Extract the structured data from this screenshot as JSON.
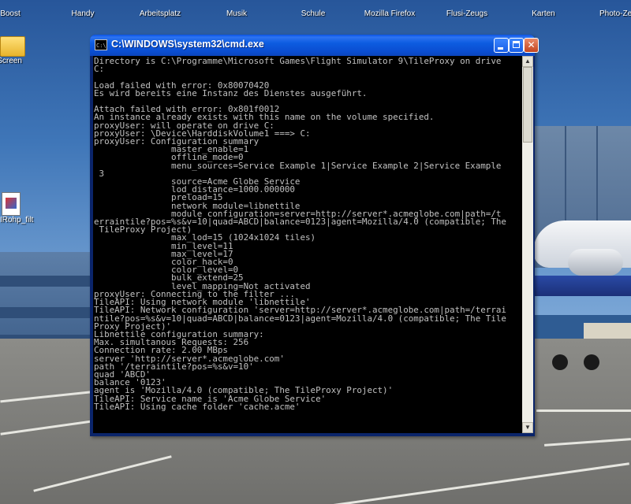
{
  "desktop": {
    "icons": [
      {
        "label": "Boost",
        "glyph": "folder-icon"
      },
      {
        "label": "Handy",
        "glyph": "folder-icon"
      },
      {
        "label": "Arbeitsplatz",
        "glyph": "computer-icon"
      },
      {
        "label": "Musik",
        "glyph": "folder-icon"
      },
      {
        "label": "Schule",
        "glyph": "folder-icon"
      },
      {
        "label": "Mozilla Firefox",
        "glyph": "firefox-icon"
      },
      {
        "label": "Flusi-Zeugs",
        "glyph": "folder-icon"
      },
      {
        "label": "Karten",
        "glyph": "folder-icon"
      },
      {
        "label": "Photo-Ze",
        "glyph": "folder-icon"
      },
      {
        "label": "Screen",
        "glyph": "folder-icon"
      },
      {
        "label": "IRohp_filt",
        "glyph": "document-icon"
      }
    ]
  },
  "window": {
    "title": "C:\\WINDOWS\\system32\\cmd.exe",
    "icon_text": "C:\\",
    "min_glyph": "_",
    "max_glyph": "□",
    "close_glyph": "✕",
    "scroll_up_glyph": "▲",
    "scroll_down_glyph": "▼"
  },
  "console": {
    "text": "Directory is C:\\Programme\\Microsoft Games\\Flight Simulator 9\\TileProxy on drive\nC:\n\nLoad failed with error: 0x80070420\nEs wird bereits eine Instanz des Dienstes ausgeführt.\n\nAttach failed with error: 0x801f0012\nAn instance already exists with this name on the volume specified.\nproxyUser: will operate on drive C:\nproxyUser: \\Device\\HarddiskVolume1 ===> C:\nproxyUser: Configuration summary\n               master_enable=1\n               offline_mode=0\n               menu_sources=Service Example 1|Service Example 2|Service Example\n 3\n               source=Acme Globe Service\n               lod_distance=1000.000000\n               preload=15\n               network module=libnettile\n               module configuration=server=http://server*.acmeglobe.com|path=/t\nerraintile?pos=%s&v=10|quad=ABCD|balance=0123|agent=Mozilla/4.0 (compatible; The\n TileProxy Project)\n               max_lod=15 (1024x1024 tiles)\n               min_level=11\n               max_level=17\n               color_hack=0\n               color_level=0\n               bulk_extend=25\n               level_mapping=Not activated\nproxyUser: Connecting to the filter ...\nTileAPI: Using network module 'libnettile'\nTileAPI: Network configuration 'server=http://server*.acmeglobe.com|path=/terrai\nntile?pos=%s&v=10|quad=ABCD|balance=0123|agent=Mozilla/4.0 (compatible; The Tile\nProxy Project)'\nLibnettile configuration summary:\nMax. simultanous Requests: 256\nConnection rate: 2.00 MBps\nserver 'http://server*.acmeglobe.com'\npath '/terraintile?pos=%s&v=10'\nquad 'ABCD'\nbalance '0123'\nagent is 'Mozilla/4.0 (compatible; The TileProxy Project)'\nTileAPI: Service name is 'Acme Globe Service'\nTileAPI: Using cache folder 'cache.acme'"
  }
}
